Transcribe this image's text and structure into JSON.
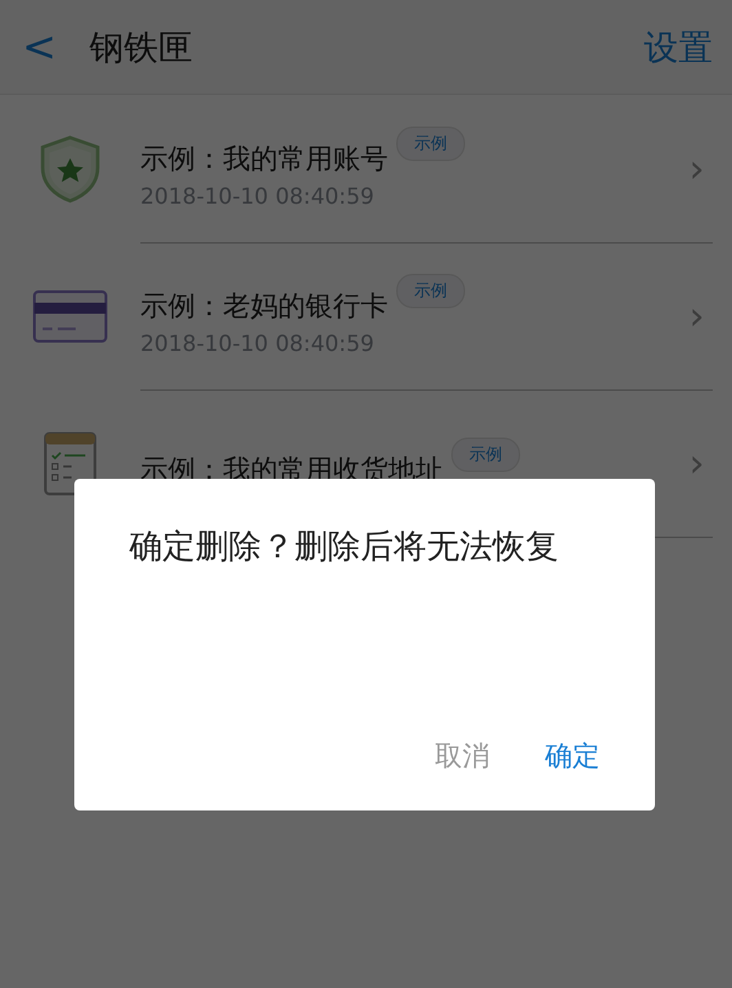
{
  "header": {
    "back": "<",
    "title": "钢铁匣",
    "action": "设置"
  },
  "items": [
    {
      "kind": "shield",
      "title": "示例：我的常用账号",
      "badge": "示例",
      "date": "2018-10-10 08:40:59",
      "chevron": "›"
    },
    {
      "kind": "card",
      "title": "示例：老妈的银行卡",
      "badge": "示例",
      "date": "2018-10-10 08:40:59",
      "chevron": "›"
    },
    {
      "kind": "checklist",
      "title": "示例：我的常用收货地址",
      "badge": "示例",
      "chevron": "›"
    }
  ],
  "dialog": {
    "message": "确定删除？删除后将无法恢复",
    "buttons": [
      {
        "kind": "cancel",
        "label": "取消"
      },
      {
        "kind": "confirm",
        "label": "确定"
      }
    ]
  }
}
